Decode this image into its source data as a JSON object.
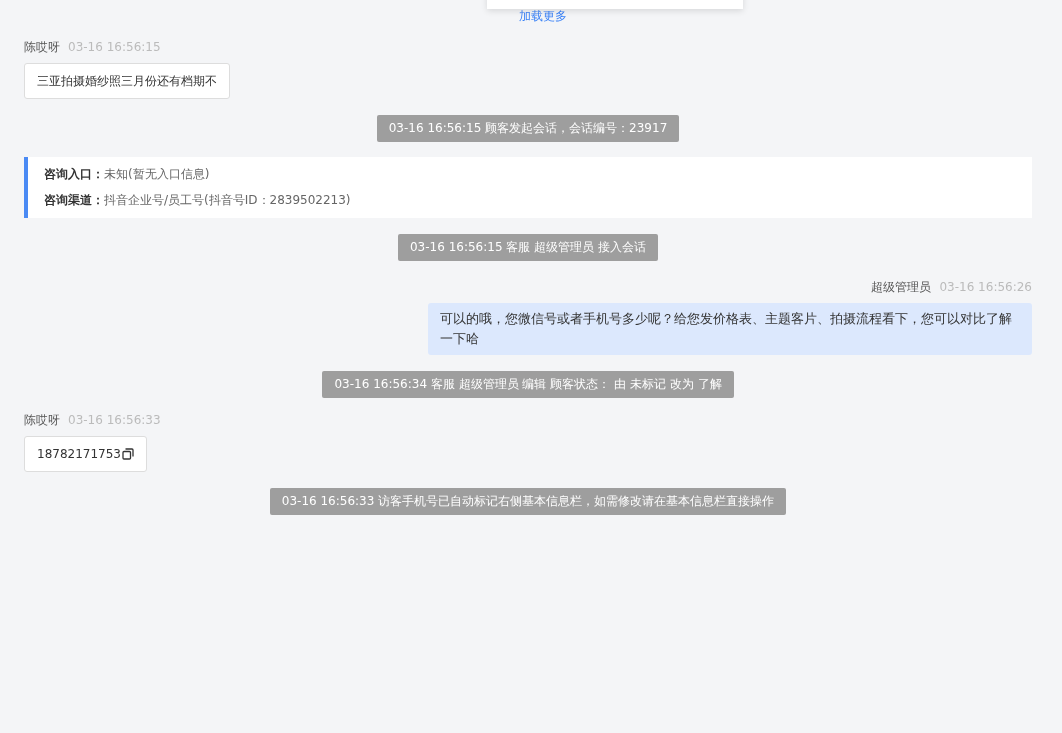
{
  "load_more": "加载更多",
  "messages": [
    {
      "kind": "customer",
      "name": "陈哎呀",
      "time": "03-16 16:56:15",
      "text": "三亚拍摄婚纱照三月份还有档期不",
      "copyable": false
    },
    {
      "kind": "system",
      "text": "03-16 16:56:15 顾客发起会话，会话编号：23917"
    },
    {
      "kind": "info",
      "rows": [
        {
          "label": "咨询入口：",
          "value": "未知(暂无入口信息)"
        },
        {
          "label": "咨询渠道：",
          "value": "抖音企业号/员工号(抖音号ID：2839502213)"
        }
      ]
    },
    {
      "kind": "system",
      "text": "03-16 16:56:15 客服 超级管理员 接入会话"
    },
    {
      "kind": "agent",
      "name": "超级管理员",
      "time": "03-16 16:56:26",
      "text": "可以的哦，您微信号或者手机号多少呢？给您发价格表、主题客片、拍摄流程看下，您可以对比了解一下哈"
    },
    {
      "kind": "system",
      "text": "03-16 16:56:34 客服 超级管理员 编辑 顾客状态： 由 未标记 改为 了解"
    },
    {
      "kind": "customer",
      "name": "陈哎呀",
      "time": "03-16 16:56:33",
      "text": "18782171753",
      "copyable": true
    },
    {
      "kind": "system",
      "text": "03-16 16:56:33 访客手机号已自动标记右侧基本信息栏，如需修改请在基本信息栏直接操作"
    }
  ]
}
